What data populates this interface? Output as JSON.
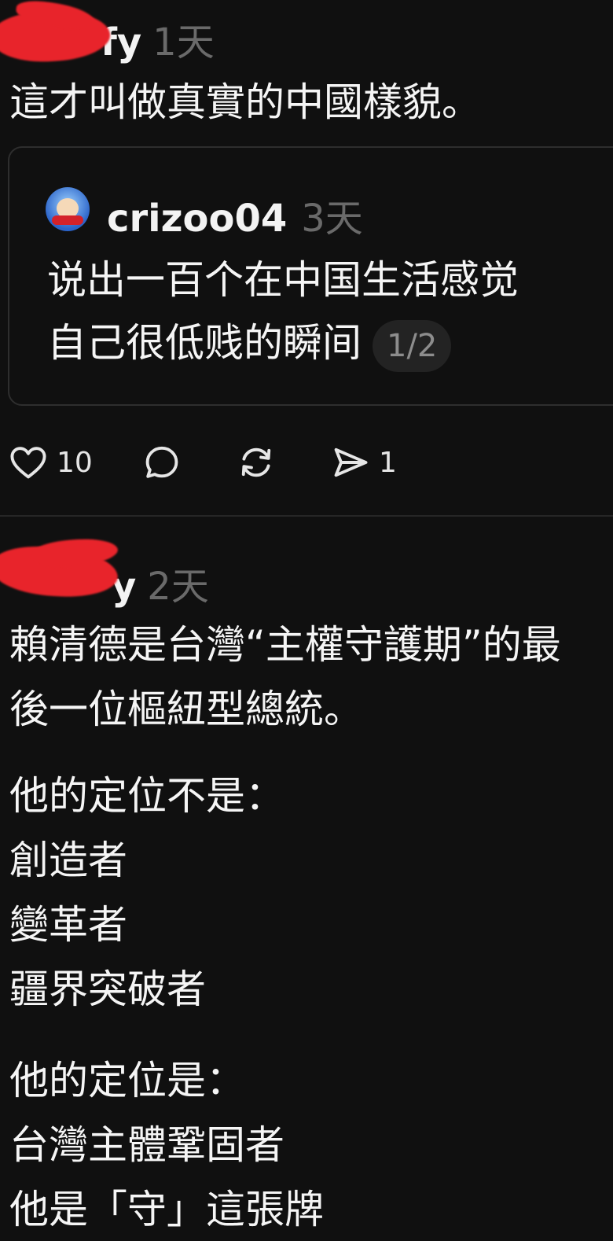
{
  "post1": {
    "username": "fy",
    "time": "1天",
    "text": "這才叫做真實的中國樣貌。",
    "quoted": {
      "username": "crizoo04",
      "time": "3天",
      "text_line1": "说出一百个在中国生活感觉",
      "text_line2": "自己很低贱的瞬间",
      "page_indicator": "1/2"
    },
    "actions": {
      "like_icon": "heart-icon",
      "like_count": "10",
      "comment_icon": "comment-icon",
      "repost_icon": "repost-icon",
      "share_icon": "send-icon",
      "share_count": "1"
    }
  },
  "post2": {
    "username": "y",
    "time": "2天",
    "lines": [
      "賴清德是台灣“主權守護期”的最",
      "後一位樞紐型總統。",
      "他的定位不是：",
      "創造者",
      "變革者",
      "疆界突破者",
      "他的定位是：",
      "台灣主體鞏固者",
      "他是「守」這張牌"
    ]
  },
  "colors": {
    "background": "#101010",
    "text": "#f3f3f3",
    "muted": "#6a6a6a",
    "redaction": "#e8242b"
  }
}
